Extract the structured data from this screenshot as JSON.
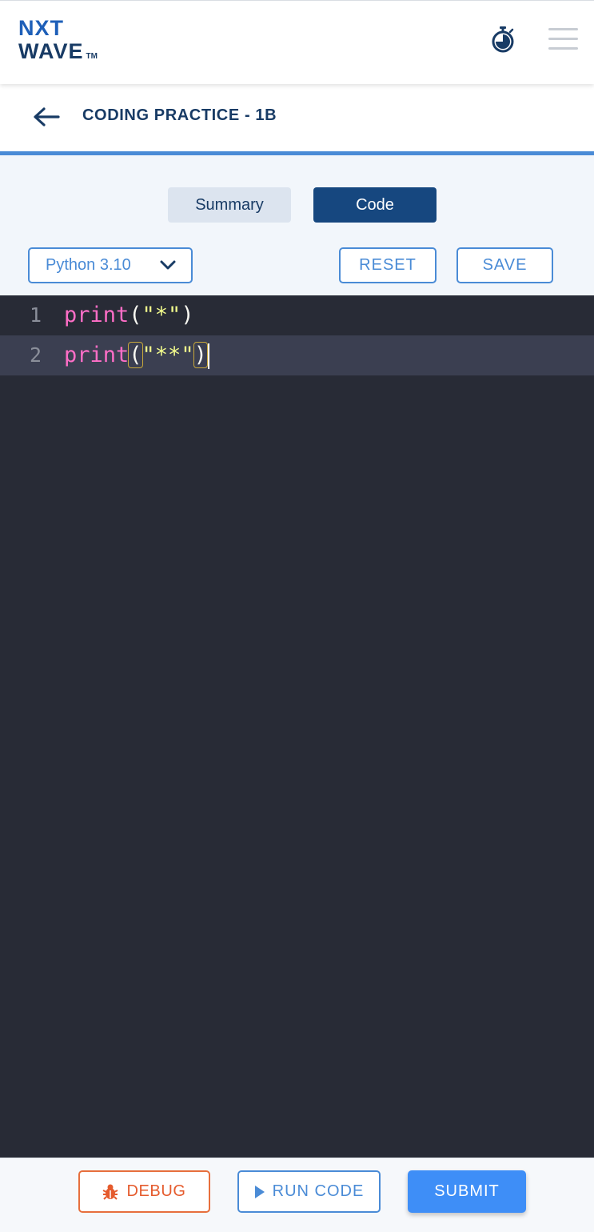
{
  "header": {
    "logo_line1": "NXT",
    "logo_line2": "WAVE",
    "logo_tm": "TM",
    "timer_icon": "stopwatch-icon",
    "menu_icon": "hamburger-menu-icon"
  },
  "titlebar": {
    "back_icon": "arrow-left-icon",
    "title": "CODING PRACTICE - 1B"
  },
  "tabs": [
    {
      "label": "Summary",
      "active": false
    },
    {
      "label": "Code",
      "active": true
    }
  ],
  "toolbar": {
    "language": "Python 3.10",
    "language_icon": "chevron-down-icon",
    "reset_label": "RESET",
    "save_label": "SAVE"
  },
  "editor": {
    "lines": [
      {
        "number": "1",
        "fn": "print",
        "open": "(",
        "str": "\"*\"",
        "close": ")"
      },
      {
        "number": "2",
        "fn": "print",
        "open": "(",
        "str": "\"**\"",
        "close": ")"
      }
    ],
    "active_line": 2
  },
  "footer": {
    "debug_label": "DEBUG",
    "debug_icon": "bug-icon",
    "run_label": "RUN CODE",
    "run_icon": "play-icon",
    "submit_label": "SUBMIT"
  },
  "colors": {
    "brand_dark": "#183b65",
    "brand_blue": "#4a8bd6",
    "tab_active": "#16477f",
    "submit": "#3e8ef7",
    "debug": "#e55b2d",
    "editor_bg": "#282b36"
  }
}
